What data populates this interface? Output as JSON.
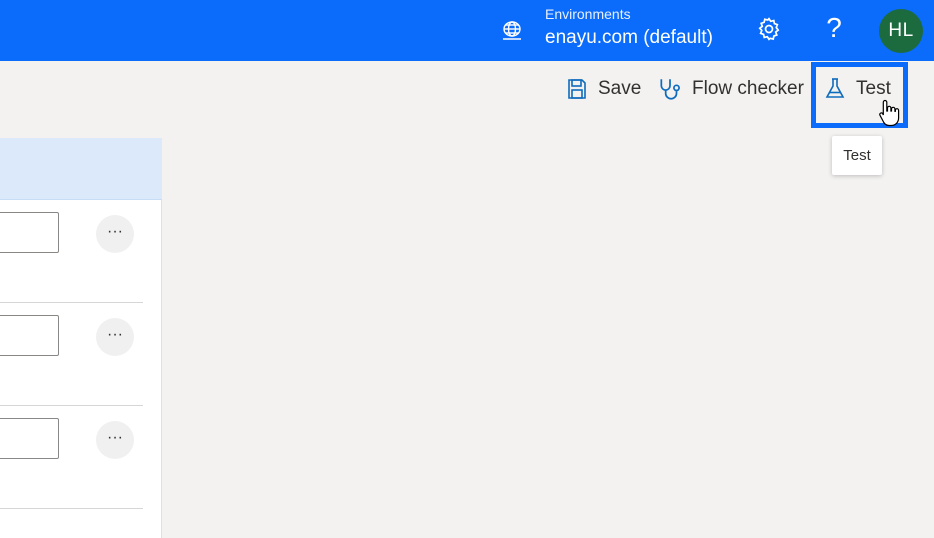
{
  "header": {
    "environment_label": "Environments",
    "environment_name": "enayu.com (default)",
    "environment_icon": "globe-icon",
    "settings_icon": "gear-icon",
    "help_label": "?",
    "avatar_initials": "HL",
    "colors": {
      "bar": "#0b6cfb",
      "avatar": "#1b6b3f"
    }
  },
  "toolbar": {
    "save_label": "Save",
    "save_icon": "save-icon",
    "flow_checker_label": "Flow checker",
    "flow_checker_icon": "stethoscope-icon",
    "test_label": "Test",
    "test_icon": "flask-icon"
  },
  "tooltip": {
    "text": "Test"
  },
  "panel": {
    "rows": [
      {
        "more_label": "···"
      },
      {
        "more_label": "···"
      },
      {
        "more_label": "···"
      }
    ]
  }
}
